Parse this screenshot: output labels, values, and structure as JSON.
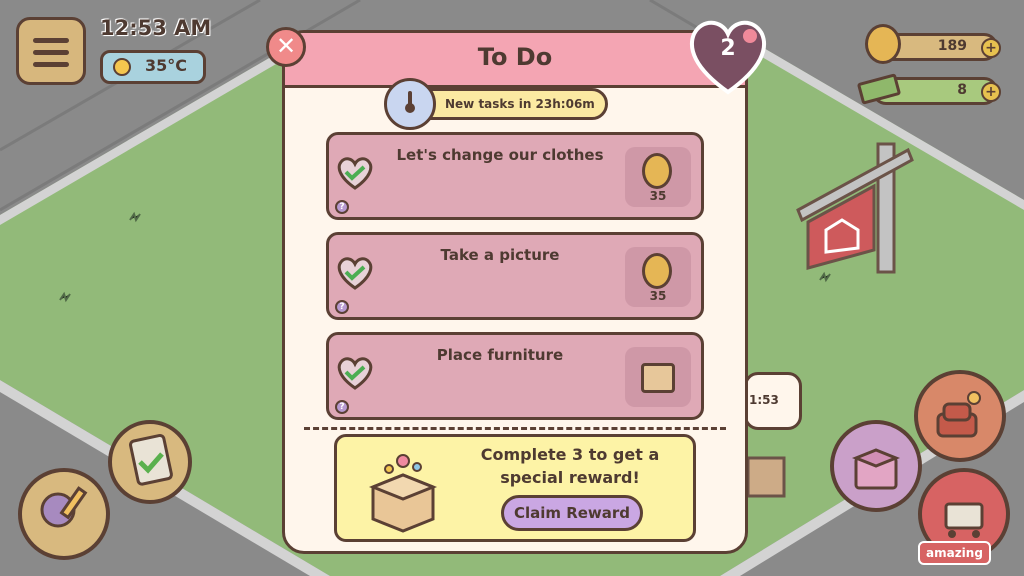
{
  "hud": {
    "time": "12:53 AM",
    "temperature": "35°C",
    "coins": "189",
    "cash": "8",
    "plus_symbol": "+",
    "shop_badge": "amazing"
  },
  "dialog": {
    "title": "To Do",
    "close_symbol": "✕",
    "remaining_count": "2",
    "timer_text": "New tasks in 23h:06m",
    "tasks": [
      {
        "title": "Let's change our clothes",
        "reward": "35",
        "reward_type": "coin"
      },
      {
        "title": "Take a picture",
        "reward": "35",
        "reward_type": "coin"
      },
      {
        "title": "Place furniture",
        "reward": "",
        "reward_type": "box"
      }
    ],
    "help_symbol": "?",
    "bonus_text": "Complete 3 to get a special reward!",
    "claim_label": "Claim Reward"
  },
  "background": {
    "bubble_time": "1:53"
  },
  "colors": {
    "outline": "#5b4034",
    "header_pink": "#f4a5b3",
    "task_bg": "#dfa9b6",
    "claim_purple": "#caa7e3",
    "grass": "#86b36a"
  }
}
